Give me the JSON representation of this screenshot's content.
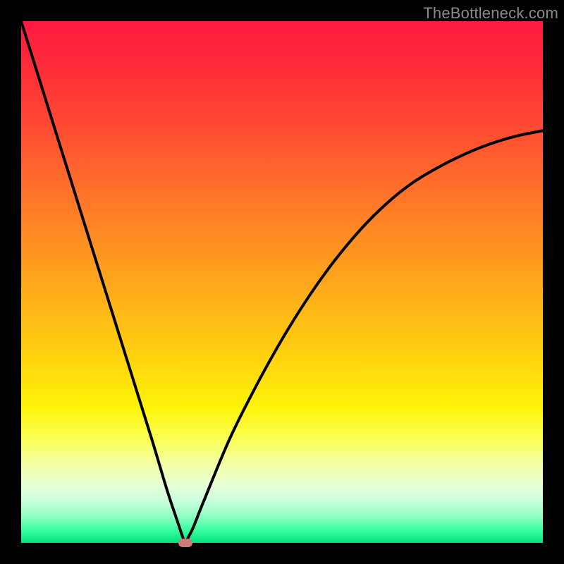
{
  "watermark": "TheBottleneck.com",
  "chart_data": {
    "type": "line",
    "title": "",
    "xlabel": "",
    "ylabel": "",
    "xlim": [
      0,
      100
    ],
    "ylim": [
      0,
      100
    ],
    "grid": false,
    "legend": false,
    "series": [
      {
        "name": "bottleneck-curve",
        "x": [
          0,
          5,
          10,
          15,
          20,
          25,
          28,
          30,
          31,
          31.5,
          32,
          33,
          35,
          40,
          45,
          50,
          55,
          60,
          65,
          70,
          75,
          80,
          85,
          90,
          95,
          100
        ],
        "y": [
          100,
          84,
          68,
          52,
          36,
          20,
          10,
          4,
          1,
          0,
          1,
          3,
          8,
          20,
          30,
          39,
          47,
          54,
          60,
          65,
          69,
          72,
          74.5,
          76.5,
          78,
          79
        ]
      }
    ],
    "marker": {
      "x": 31.5,
      "y": 0
    },
    "background_gradient": {
      "top": "#ff1a3f",
      "mid": "#ffd40e",
      "bottom": "#00e27a"
    }
  }
}
